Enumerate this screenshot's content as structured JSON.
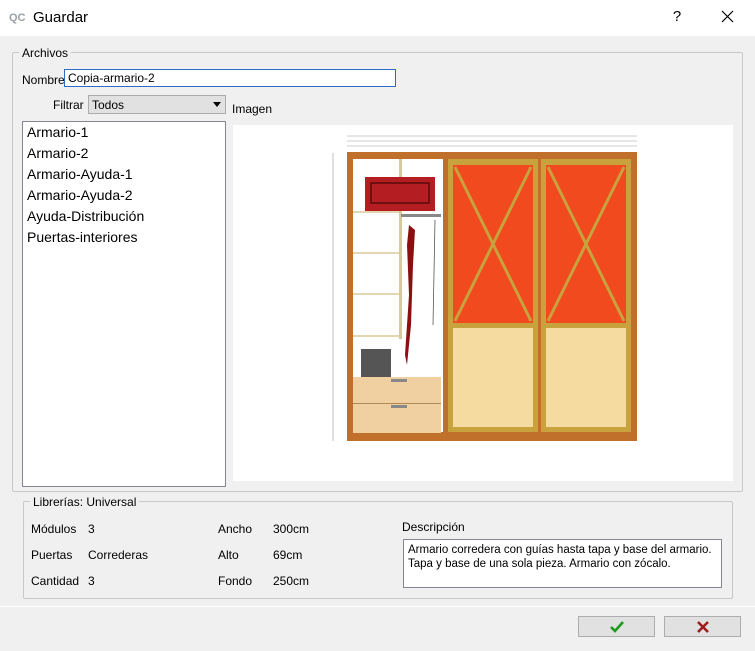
{
  "window": {
    "title": "Guardar",
    "help_glyph": "?",
    "app_icon": "qc-app-icon"
  },
  "archivos": {
    "legend": "Archivos",
    "nombre_label": "Nombre",
    "nombre_value": "Copia-armario-2",
    "filtrar_label": "Filtrar",
    "filtrar_value": "Todos",
    "imagen_label": "Imagen",
    "files": [
      "Armario-1",
      "Armario-2",
      "Armario-Ayuda-1",
      "Armario-Ayuda-2",
      "Ayuda-Distribución",
      "Puertas-interiores"
    ]
  },
  "librerias": {
    "legend": "Librerías: Universal",
    "modulos_label": "Módulos",
    "modulos_value": "3",
    "puertas_label": "Puertas",
    "puertas_value": "Correderas",
    "cantidad_label": "Cantidad",
    "cantidad_value": "3",
    "ancho_label": "Ancho",
    "ancho_value": "300cm",
    "alto_label": "Alto",
    "alto_value": "69cm",
    "fondo_label": "Fondo",
    "fondo_value": "250cm",
    "descripcion_label": "Descripción",
    "descripcion_line1": "Armario corredera con guías hasta tapa y base del armario.",
    "descripcion_line2": "Tapa y base de una sola pieza. Armario con zócalo."
  },
  "buttons": {
    "ok_icon": "check-icon",
    "cancel_icon": "x-icon",
    "ok_color": "#1e9b1e",
    "cancel_color": "#9b1e1e"
  },
  "colors": {
    "wood": "#c0702a",
    "door_orange": "#f04a1e",
    "door_beige": "#f6dba0",
    "frame_gold": "#c8a23c"
  }
}
